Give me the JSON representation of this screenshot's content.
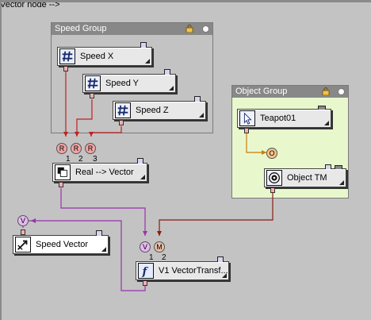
{
  "groups": {
    "speed": {
      "title": "Speed Group"
    },
    "object": {
      "title": "Object Group"
    }
  },
  "nodes": {
    "speed_x": {
      "label": "Speed X",
      "icon": "hash-icon"
    },
    "speed_y": {
      "label": "Speed Y",
      "icon": "hash-icon"
    },
    "speed_z": {
      "label": "Speed Z",
      "icon": "hash-icon"
    },
    "teapot": {
      "label": "Teapot01",
      "icon": "pointer-arrow-icon"
    },
    "object_tm": {
      "label": "Object TM",
      "icon": "object-tm-icon"
    },
    "real_vector": {
      "label": "Real --> Vector",
      "icon": "converter-icon"
    },
    "speed_vector": {
      "label": "Speed Vector",
      "icon": "vector-arrow-icon"
    },
    "vector_transform": {
      "label": "V1 VectorTransf...",
      "icon": "function-icon"
    }
  },
  "pins": {
    "r1": "R",
    "r2": "R",
    "r3": "R",
    "o": "O",
    "v_out": "V",
    "v_in": "V",
    "m_in": "M",
    "num1": "1",
    "num2": "2",
    "num3": "3",
    "vt1": "1",
    "vt2": "2"
  },
  "colors": {
    "background": "#c3c3c3",
    "speed_group_bg": "#c3c3c3",
    "object_group_bg": "#e8f8cc",
    "group_header": "#888888",
    "wire_red": "#c02020",
    "wire_purple": "#9933aa",
    "wire_orange": "#cc7a10",
    "wire_darkred": "#8a1a10"
  }
}
